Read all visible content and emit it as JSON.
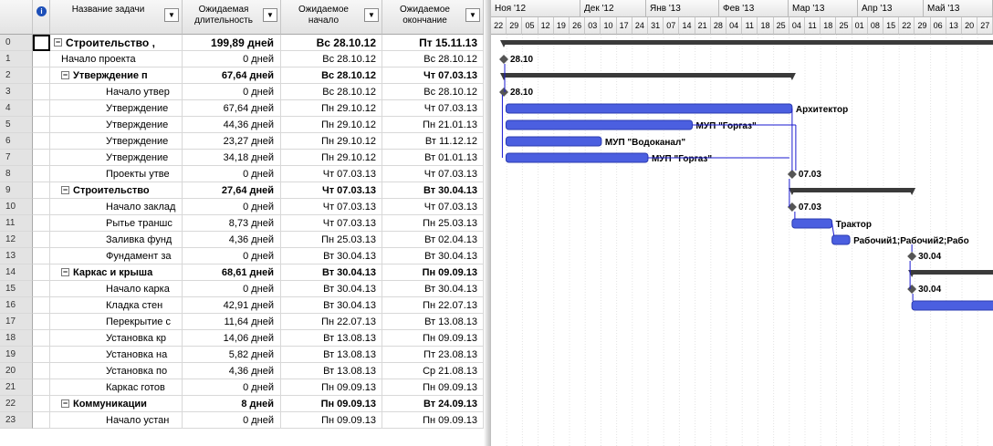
{
  "columns": {
    "id": "",
    "info": "i",
    "name": "Название задачи",
    "duration": "Ожидаемая длительность",
    "start": "Ожидаемое начало",
    "finish": "Ожидаемое окончание"
  },
  "tasks": [
    {
      "id": "0",
      "name": "Строительство ,",
      "duration": "199,89 дней",
      "start": "Вс 28.10.12",
      "finish": "Пт 15.11.13",
      "summary": true,
      "level": 0,
      "selected": true
    },
    {
      "id": "1",
      "name": "Начало проекта",
      "duration": "0 дней",
      "start": "Вс 28.10.12",
      "finish": "Вс 28.10.12",
      "summary": false,
      "level": 1
    },
    {
      "id": "2",
      "name": "Утверждение п",
      "duration": "67,64 дней",
      "start": "Вс 28.10.12",
      "finish": "Чт 07.03.13",
      "summary": true,
      "level": 1
    },
    {
      "id": "3",
      "name": "Начало утвер",
      "duration": "0 дней",
      "start": "Вс 28.10.12",
      "finish": "Вс 28.10.12",
      "summary": false,
      "level": 2
    },
    {
      "id": "4",
      "name": "Утверждение",
      "duration": "67,64 дней",
      "start": "Пн 29.10.12",
      "finish": "Чт 07.03.13",
      "summary": false,
      "level": 2
    },
    {
      "id": "5",
      "name": "Утверждение",
      "duration": "44,36 дней",
      "start": "Пн 29.10.12",
      "finish": "Пн 21.01.13",
      "summary": false,
      "level": 2
    },
    {
      "id": "6",
      "name": "Утверждение",
      "duration": "23,27 дней",
      "start": "Пн 29.10.12",
      "finish": "Вт 11.12.12",
      "summary": false,
      "level": 2
    },
    {
      "id": "7",
      "name": "Утверждение",
      "duration": "34,18 дней",
      "start": "Пн 29.10.12",
      "finish": "Вт 01.01.13",
      "summary": false,
      "level": 2
    },
    {
      "id": "8",
      "name": "Проекты утве",
      "duration": "0 дней",
      "start": "Чт 07.03.13",
      "finish": "Чт 07.03.13",
      "summary": false,
      "level": 2
    },
    {
      "id": "9",
      "name": "Строительство",
      "duration": "27,64 дней",
      "start": "Чт 07.03.13",
      "finish": "Вт 30.04.13",
      "summary": true,
      "level": 1
    },
    {
      "id": "10",
      "name": "Начало заклад",
      "duration": "0 дней",
      "start": "Чт 07.03.13",
      "finish": "Чт 07.03.13",
      "summary": false,
      "level": 2
    },
    {
      "id": "11",
      "name": "Рытье траншс",
      "duration": "8,73 дней",
      "start": "Чт 07.03.13",
      "finish": "Пн 25.03.13",
      "summary": false,
      "level": 2
    },
    {
      "id": "12",
      "name": "Заливка фунд",
      "duration": "4,36 дней",
      "start": "Пн 25.03.13",
      "finish": "Вт 02.04.13",
      "summary": false,
      "level": 2
    },
    {
      "id": "13",
      "name": "Фундамент за",
      "duration": "0 дней",
      "start": "Вт 30.04.13",
      "finish": "Вт 30.04.13",
      "summary": false,
      "level": 2
    },
    {
      "id": "14",
      "name": "Каркас и крыша",
      "duration": "68,61 дней",
      "start": "Вт 30.04.13",
      "finish": "Пн 09.09.13",
      "summary": true,
      "level": 1
    },
    {
      "id": "15",
      "name": "Начало карка",
      "duration": "0 дней",
      "start": "Вт 30.04.13",
      "finish": "Вт 30.04.13",
      "summary": false,
      "level": 2
    },
    {
      "id": "16",
      "name": "Кладка стен",
      "duration": "42,91 дней",
      "start": "Вт 30.04.13",
      "finish": "Пн 22.07.13",
      "summary": false,
      "level": 2
    },
    {
      "id": "17",
      "name": "Перекрытие с",
      "duration": "11,64 дней",
      "start": "Пн 22.07.13",
      "finish": "Вт 13.08.13",
      "summary": false,
      "level": 2
    },
    {
      "id": "18",
      "name": "Установка кр",
      "duration": "14,06 дней",
      "start": "Вт 13.08.13",
      "finish": "Пн 09.09.13",
      "summary": false,
      "level": 2
    },
    {
      "id": "19",
      "name": "Установка на",
      "duration": "5,82 дней",
      "start": "Вт 13.08.13",
      "finish": "Пт 23.08.13",
      "summary": false,
      "level": 2
    },
    {
      "id": "20",
      "name": "Установка по",
      "duration": "4,36 дней",
      "start": "Вт 13.08.13",
      "finish": "Ср 21.08.13",
      "summary": false,
      "level": 2
    },
    {
      "id": "21",
      "name": "Каркас готов",
      "duration": "0 дней",
      "start": "Пн 09.09.13",
      "finish": "Пн 09.09.13",
      "summary": false,
      "level": 2
    },
    {
      "id": "22",
      "name": "Коммуникации",
      "duration": "8 дней",
      "start": "Пн 09.09.13",
      "finish": "Вт 24.09.13",
      "summary": true,
      "level": 1
    },
    {
      "id": "23",
      "name": "Начало устан",
      "duration": "0 дней",
      "start": "Пн 09.09.13",
      "finish": "Пн 09.09.13",
      "summary": false,
      "level": 2
    }
  ],
  "timescale": {
    "months": [
      "Ноя '12",
      "Дек '12",
      "Янв '13",
      "Фев '13",
      "Мар '13",
      "Апр '13",
      "Май '13"
    ],
    "days": [
      "22",
      "29",
      "05",
      "12",
      "19",
      "26",
      "03",
      "10",
      "17",
      "24",
      "31",
      "07",
      "14",
      "21",
      "28",
      "04",
      "11",
      "18",
      "25",
      "04",
      "11",
      "18",
      "25",
      "01",
      "08",
      "15",
      "22",
      "29",
      "06",
      "13",
      "20",
      "27"
    ]
  },
  "gantt": {
    "bars": [
      {
        "row": 0,
        "type": "summary",
        "start": "28.10.12",
        "finish": "15.11.13",
        "label": ""
      },
      {
        "row": 1,
        "type": "milestone",
        "date": "28.10.12",
        "label": "28.10"
      },
      {
        "row": 2,
        "type": "summary",
        "start": "28.10.12",
        "finish": "07.03.13",
        "label": ""
      },
      {
        "row": 3,
        "type": "milestone",
        "date": "28.10.12",
        "label": "28.10"
      },
      {
        "row": 4,
        "type": "task",
        "start": "29.10.12",
        "finish": "07.03.13",
        "label": "Архитектор"
      },
      {
        "row": 5,
        "type": "task",
        "start": "29.10.12",
        "finish": "21.01.13",
        "label": "МУП \"Горгаз\""
      },
      {
        "row": 6,
        "type": "task",
        "start": "29.10.12",
        "finish": "11.12.12",
        "label": "МУП \"Водоканал\""
      },
      {
        "row": 7,
        "type": "task",
        "start": "29.10.12",
        "finish": "01.01.13",
        "label": "МУП \"Горгаз\""
      },
      {
        "row": 8,
        "type": "milestone",
        "date": "07.03.13",
        "label": "07.03"
      },
      {
        "row": 9,
        "type": "summary",
        "start": "07.03.13",
        "finish": "30.04.13",
        "label": ""
      },
      {
        "row": 10,
        "type": "milestone",
        "date": "07.03.13",
        "label": "07.03"
      },
      {
        "row": 11,
        "type": "task",
        "start": "07.03.13",
        "finish": "25.03.13",
        "label": "Трактор"
      },
      {
        "row": 12,
        "type": "task",
        "start": "25.03.13",
        "finish": "02.04.13",
        "label": "Рабочий1;Рабочий2;Рабо"
      },
      {
        "row": 13,
        "type": "milestone",
        "date": "30.04.13",
        "label": "30.04"
      },
      {
        "row": 14,
        "type": "summary",
        "start": "30.04.13",
        "finish": "09.09.13",
        "label": ""
      },
      {
        "row": 15,
        "type": "milestone",
        "date": "30.04.13",
        "label": "30.04"
      },
      {
        "row": 16,
        "type": "task",
        "start": "30.04.13",
        "finish": "22.07.13",
        "label": ""
      }
    ],
    "colors": {
      "task": "#4b5fe0",
      "summary": "#3a3a3a",
      "link": "#1a1ad0",
      "milestone": "#555555"
    }
  }
}
